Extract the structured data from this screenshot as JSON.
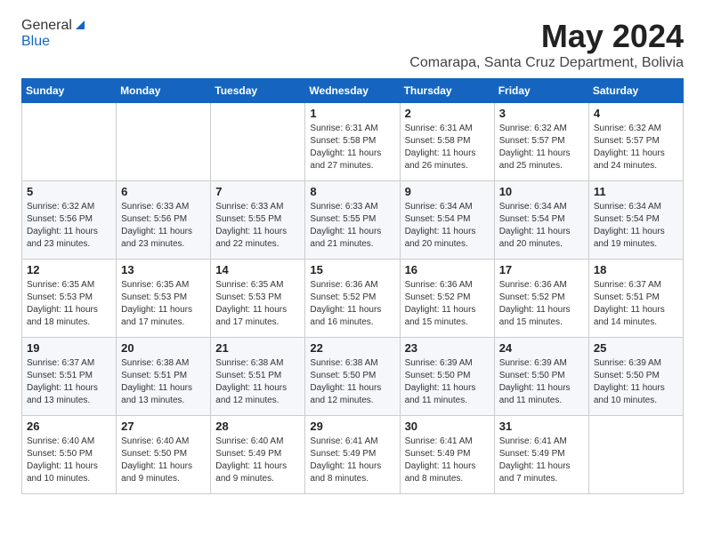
{
  "header": {
    "logo_general": "General",
    "logo_blue": "Blue",
    "month_year": "May 2024",
    "location": "Comarapa, Santa Cruz Department, Bolivia"
  },
  "days_of_week": [
    "Sunday",
    "Monday",
    "Tuesday",
    "Wednesday",
    "Thursday",
    "Friday",
    "Saturday"
  ],
  "weeks": [
    [
      {
        "day": "",
        "info": ""
      },
      {
        "day": "",
        "info": ""
      },
      {
        "day": "",
        "info": ""
      },
      {
        "day": "1",
        "info": "Sunrise: 6:31 AM\nSunset: 5:58 PM\nDaylight: 11 hours\nand 27 minutes."
      },
      {
        "day": "2",
        "info": "Sunrise: 6:31 AM\nSunset: 5:58 PM\nDaylight: 11 hours\nand 26 minutes."
      },
      {
        "day": "3",
        "info": "Sunrise: 6:32 AM\nSunset: 5:57 PM\nDaylight: 11 hours\nand 25 minutes."
      },
      {
        "day": "4",
        "info": "Sunrise: 6:32 AM\nSunset: 5:57 PM\nDaylight: 11 hours\nand 24 minutes."
      }
    ],
    [
      {
        "day": "5",
        "info": "Sunrise: 6:32 AM\nSunset: 5:56 PM\nDaylight: 11 hours\nand 23 minutes."
      },
      {
        "day": "6",
        "info": "Sunrise: 6:33 AM\nSunset: 5:56 PM\nDaylight: 11 hours\nand 23 minutes."
      },
      {
        "day": "7",
        "info": "Sunrise: 6:33 AM\nSunset: 5:55 PM\nDaylight: 11 hours\nand 22 minutes."
      },
      {
        "day": "8",
        "info": "Sunrise: 6:33 AM\nSunset: 5:55 PM\nDaylight: 11 hours\nand 21 minutes."
      },
      {
        "day": "9",
        "info": "Sunrise: 6:34 AM\nSunset: 5:54 PM\nDaylight: 11 hours\nand 20 minutes."
      },
      {
        "day": "10",
        "info": "Sunrise: 6:34 AM\nSunset: 5:54 PM\nDaylight: 11 hours\nand 20 minutes."
      },
      {
        "day": "11",
        "info": "Sunrise: 6:34 AM\nSunset: 5:54 PM\nDaylight: 11 hours\nand 19 minutes."
      }
    ],
    [
      {
        "day": "12",
        "info": "Sunrise: 6:35 AM\nSunset: 5:53 PM\nDaylight: 11 hours\nand 18 minutes."
      },
      {
        "day": "13",
        "info": "Sunrise: 6:35 AM\nSunset: 5:53 PM\nDaylight: 11 hours\nand 17 minutes."
      },
      {
        "day": "14",
        "info": "Sunrise: 6:35 AM\nSunset: 5:53 PM\nDaylight: 11 hours\nand 17 minutes."
      },
      {
        "day": "15",
        "info": "Sunrise: 6:36 AM\nSunset: 5:52 PM\nDaylight: 11 hours\nand 16 minutes."
      },
      {
        "day": "16",
        "info": "Sunrise: 6:36 AM\nSunset: 5:52 PM\nDaylight: 11 hours\nand 15 minutes."
      },
      {
        "day": "17",
        "info": "Sunrise: 6:36 AM\nSunset: 5:52 PM\nDaylight: 11 hours\nand 15 minutes."
      },
      {
        "day": "18",
        "info": "Sunrise: 6:37 AM\nSunset: 5:51 PM\nDaylight: 11 hours\nand 14 minutes."
      }
    ],
    [
      {
        "day": "19",
        "info": "Sunrise: 6:37 AM\nSunset: 5:51 PM\nDaylight: 11 hours\nand 13 minutes."
      },
      {
        "day": "20",
        "info": "Sunrise: 6:38 AM\nSunset: 5:51 PM\nDaylight: 11 hours\nand 13 minutes."
      },
      {
        "day": "21",
        "info": "Sunrise: 6:38 AM\nSunset: 5:51 PM\nDaylight: 11 hours\nand 12 minutes."
      },
      {
        "day": "22",
        "info": "Sunrise: 6:38 AM\nSunset: 5:50 PM\nDaylight: 11 hours\nand 12 minutes."
      },
      {
        "day": "23",
        "info": "Sunrise: 6:39 AM\nSunset: 5:50 PM\nDaylight: 11 hours\nand 11 minutes."
      },
      {
        "day": "24",
        "info": "Sunrise: 6:39 AM\nSunset: 5:50 PM\nDaylight: 11 hours\nand 11 minutes."
      },
      {
        "day": "25",
        "info": "Sunrise: 6:39 AM\nSunset: 5:50 PM\nDaylight: 11 hours\nand 10 minutes."
      }
    ],
    [
      {
        "day": "26",
        "info": "Sunrise: 6:40 AM\nSunset: 5:50 PM\nDaylight: 11 hours\nand 10 minutes."
      },
      {
        "day": "27",
        "info": "Sunrise: 6:40 AM\nSunset: 5:50 PM\nDaylight: 11 hours\nand 9 minutes."
      },
      {
        "day": "28",
        "info": "Sunrise: 6:40 AM\nSunset: 5:49 PM\nDaylight: 11 hours\nand 9 minutes."
      },
      {
        "day": "29",
        "info": "Sunrise: 6:41 AM\nSunset: 5:49 PM\nDaylight: 11 hours\nand 8 minutes."
      },
      {
        "day": "30",
        "info": "Sunrise: 6:41 AM\nSunset: 5:49 PM\nDaylight: 11 hours\nand 8 minutes."
      },
      {
        "day": "31",
        "info": "Sunrise: 6:41 AM\nSunset: 5:49 PM\nDaylight: 11 hours\nand 7 minutes."
      },
      {
        "day": "",
        "info": ""
      }
    ]
  ]
}
